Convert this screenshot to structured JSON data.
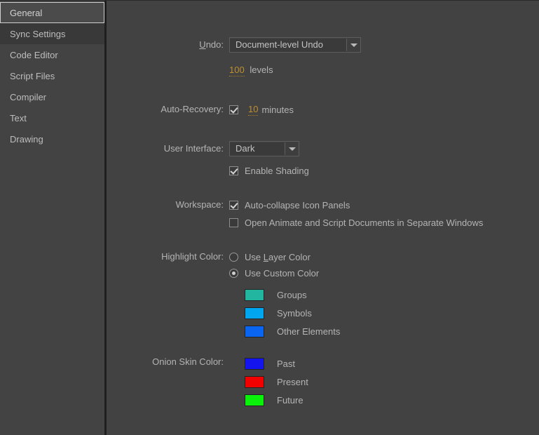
{
  "sidebar": {
    "items": [
      {
        "label": "General",
        "state": "selected"
      },
      {
        "label": "Sync Settings",
        "state": "hover"
      },
      {
        "label": "Code Editor",
        "state": "normal"
      },
      {
        "label": "Script Files",
        "state": "normal"
      },
      {
        "label": "Compiler",
        "state": "normal"
      },
      {
        "label": "Text",
        "state": "normal"
      },
      {
        "label": "Drawing",
        "state": "normal"
      }
    ]
  },
  "undo": {
    "label_prefix": "",
    "label_accel": "U",
    "label_suffix": "ndo:",
    "mode_value": "Document-level Undo",
    "levels_value": "100",
    "levels_unit": "levels",
    "arrow_icon": "chevron-down-icon"
  },
  "auto_recovery": {
    "label": "Auto-Recovery:",
    "checked": true,
    "minutes_value": "10",
    "minutes_unit": "minutes"
  },
  "user_interface": {
    "label": "User Interface:",
    "theme_value": "Dark",
    "arrow_icon": "chevron-down-icon",
    "enable_shading_label": "Enable Shading",
    "enable_shading_checked": true
  },
  "workspace": {
    "label": "Workspace:",
    "options": [
      {
        "label": "Auto-collapse Icon Panels",
        "checked": true
      },
      {
        "label": "Open Animate and Script Documents in Separate Windows",
        "checked": false
      }
    ]
  },
  "highlight_color": {
    "label": "Highlight Color:",
    "radios": [
      {
        "label_prefix": "Use ",
        "label_accel": "L",
        "label_suffix": "ayer Color",
        "selected": false
      },
      {
        "label_prefix": "Use Custom Color",
        "label_accel": "",
        "label_suffix": "",
        "selected": true
      }
    ],
    "swatches": [
      {
        "label": "Groups",
        "color": "#22b5a0"
      },
      {
        "label": "Symbols",
        "color": "#00a6f0"
      },
      {
        "label": "Other Elements",
        "color": "#0a66f0"
      }
    ]
  },
  "onion_skin_color": {
    "label": "Onion Skin Color:",
    "swatches": [
      {
        "label": "Past",
        "color": "#1414ee"
      },
      {
        "label": "Present",
        "color": "#f20000"
      },
      {
        "label": "Future",
        "color": "#0af20a"
      }
    ]
  },
  "theme": {
    "background": "#424242",
    "sidebar_background": "#434343",
    "text": "#b4b4b4",
    "hot_text": "#bf8f30"
  }
}
